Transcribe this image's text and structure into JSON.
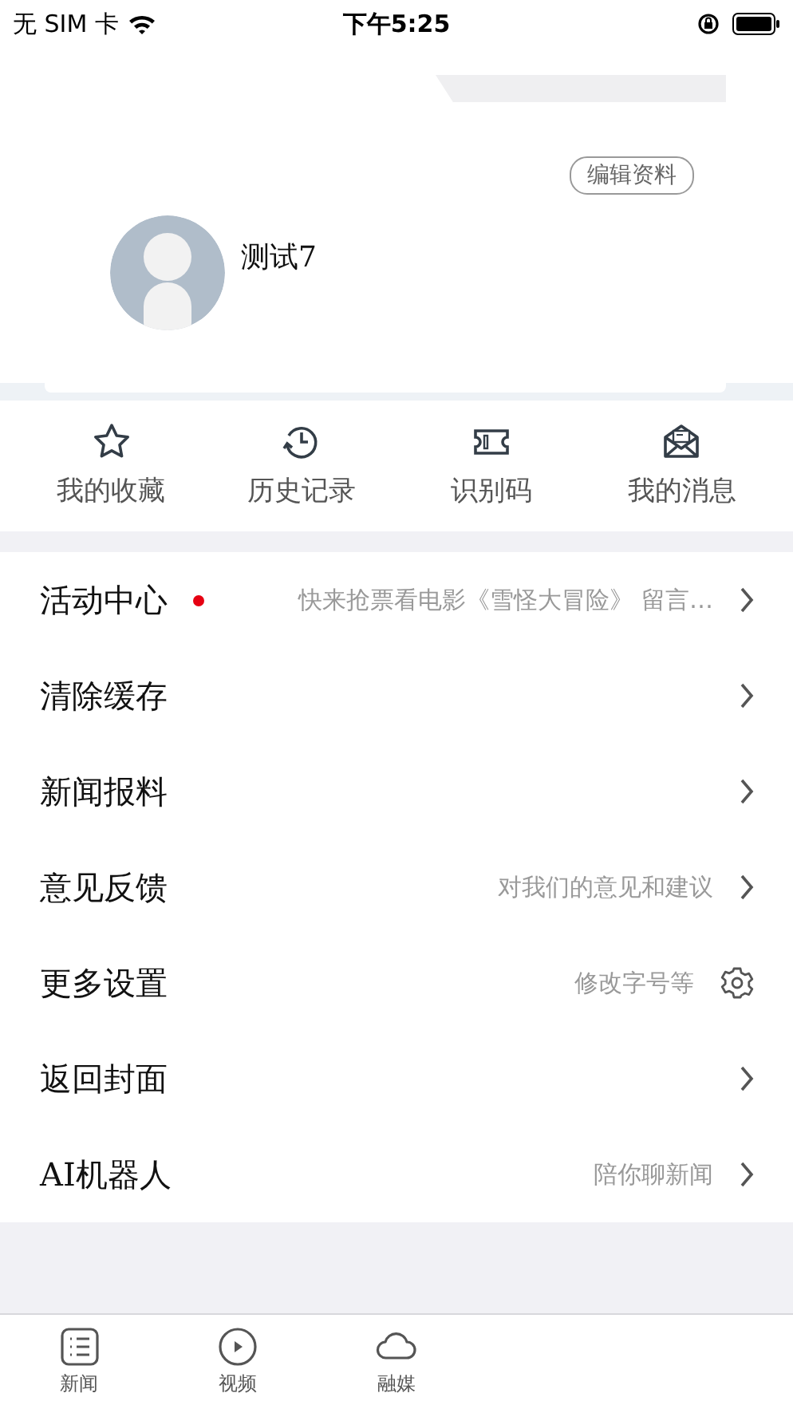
{
  "status_bar": {
    "carrier": "无 SIM 卡",
    "time": "下午5:25"
  },
  "profile": {
    "edit_button": "编辑资料",
    "name": "测试7"
  },
  "shortcuts": [
    {
      "label": "我的收藏",
      "kind": "star"
    },
    {
      "label": "历史记录",
      "kind": "history"
    },
    {
      "label": "识别码",
      "kind": "ticket"
    },
    {
      "label": "我的消息",
      "kind": "mail"
    }
  ],
  "menu": [
    {
      "label": "活动中心",
      "has_dot": true,
      "detail": "快来抢票看电影《雪怪大冒险》 留言…",
      "kind": "link"
    },
    {
      "label": "清除缓存",
      "has_dot": false,
      "kind": "link"
    },
    {
      "label": "新闻报料",
      "has_dot": false,
      "kind": "link"
    },
    {
      "label": "意见反馈",
      "has_dot": false,
      "detail": "对我们的意见和建议",
      "kind": "link"
    },
    {
      "label": "更多设置",
      "has_dot": false,
      "detail": "修改字号等",
      "kind": "settings"
    },
    {
      "label": "返回封面",
      "has_dot": false,
      "kind": "link"
    },
    {
      "label": "AI机器人",
      "has_dot": false,
      "detail": "陪你聊新闻",
      "kind": "link"
    }
  ],
  "tab_bar": [
    {
      "label": "新闻",
      "selected": false
    },
    {
      "label": "视频",
      "selected": false
    },
    {
      "label": "融媒",
      "selected": false
    }
  ]
}
